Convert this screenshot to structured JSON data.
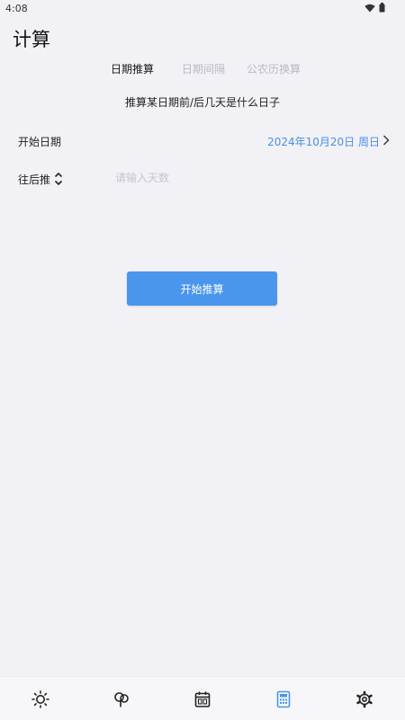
{
  "status": {
    "time": "4:08"
  },
  "page": {
    "title": "计算"
  },
  "tabs": [
    {
      "label": "日期推算",
      "active": true
    },
    {
      "label": "日期间隔",
      "active": false
    },
    {
      "label": "公农历换算",
      "active": false
    }
  ],
  "subtitle": "推算某日期前/后几天是什么日子",
  "start_date": {
    "label": "开始日期",
    "value": "2024年10月20日 周日"
  },
  "offset": {
    "label": "往后推",
    "placeholder": "请输入天数",
    "value": ""
  },
  "action": {
    "label": "开始推算"
  },
  "bottom_nav": [
    {
      "icon": "sun-icon",
      "active": false
    },
    {
      "icon": "tree-icon",
      "active": false
    },
    {
      "icon": "calendar-icon",
      "active": false
    },
    {
      "icon": "calculator-icon",
      "active": true
    },
    {
      "icon": "gear-icon",
      "active": false
    }
  ],
  "colors": {
    "accent": "#4a96ec",
    "date_text": "#4a90e2",
    "background": "#f2f1f6",
    "inactive_tab": "#b9b9bf"
  }
}
